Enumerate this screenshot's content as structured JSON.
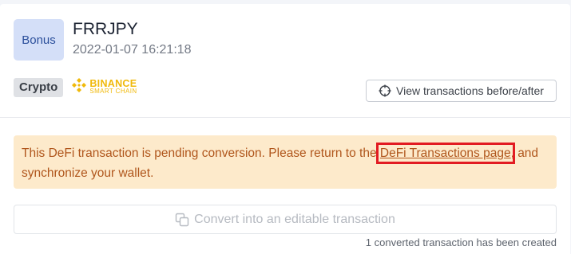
{
  "header": {
    "badge_label": "Bonus",
    "title": "FRRJPY",
    "timestamp": "2022-01-07 16:21:18"
  },
  "tags": {
    "crypto_label": "Crypto",
    "chain_line1": "BINANCE",
    "chain_line2": "SMART CHAIN",
    "chain_icon": "binance-logo-icon",
    "chain_color": "#f0b90b"
  },
  "actions": {
    "view_transactions_label": "View transactions before/after",
    "view_transactions_icon": "crosshair-icon",
    "convert_label": "Convert into an editable transaction",
    "convert_icon": "copy-icon"
  },
  "alert": {
    "text_before": "This DeFi transaction is pending conversion. Please return to the ",
    "link_text": "DeFi Transactions page",
    "text_after": ", and synchronize your wallet.",
    "background_color": "#fdeacb",
    "text_color": "#b0561c",
    "highlight_color": "#e21b22"
  },
  "footer": {
    "note": "1 converted transaction has been created"
  }
}
